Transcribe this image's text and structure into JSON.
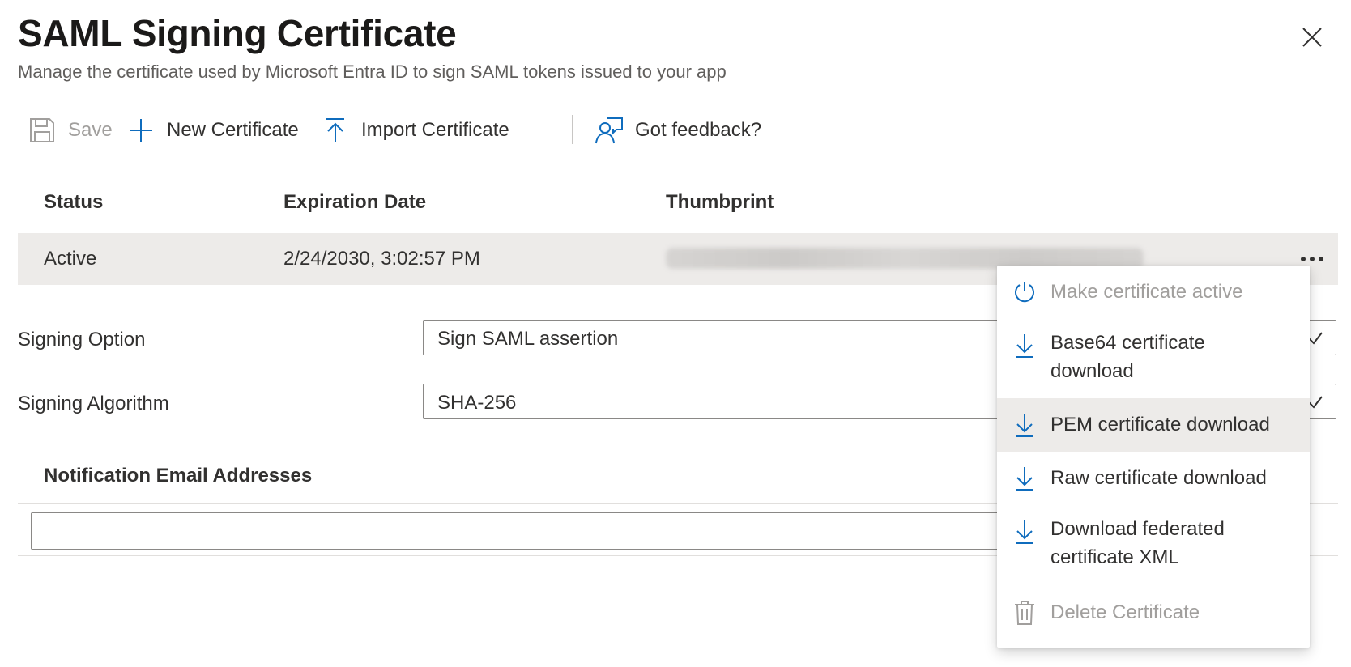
{
  "panel": {
    "title": "SAML Signing Certificate",
    "subtitle": "Manage the certificate used by Microsoft Entra ID to sign SAML tokens issued to your app"
  },
  "toolbar": {
    "save_label": "Save",
    "new_certificate_label": "New Certificate",
    "import_certificate_label": "Import Certificate",
    "feedback_label": "Got feedback?"
  },
  "table": {
    "headers": [
      "Status",
      "Expiration Date",
      "Thumbprint"
    ],
    "rows": [
      {
        "status": "Active",
        "expiration": "2/24/2030, 3:02:57 PM"
      }
    ]
  },
  "form": {
    "signing_option_label": "Signing Option",
    "signing_option_value": "Sign SAML assertion",
    "signing_algorithm_label": "Signing Algorithm",
    "signing_algorithm_value": "SHA-256",
    "notification_title": "Notification Email Addresses",
    "notification_email_value": ""
  },
  "context_menu": {
    "items": [
      {
        "label": "Make certificate active",
        "icon": "power-icon",
        "disabled": true
      },
      {
        "label": "Base64 certificate download",
        "icon": "download-icon",
        "disabled": false
      },
      {
        "label": "PEM certificate download",
        "icon": "download-icon",
        "disabled": false,
        "hovered": true
      },
      {
        "label": "Raw certificate download",
        "icon": "download-icon",
        "disabled": false
      },
      {
        "label": "Download federated certificate XML",
        "icon": "download-icon",
        "disabled": false
      },
      {
        "label": "Delete Certificate",
        "icon": "trash-icon",
        "disabled": true
      }
    ]
  },
  "colors": {
    "accent": "#0f6cbd",
    "text": "#323130",
    "disabled": "#a19f9d",
    "row_selected": "#edebe9"
  }
}
